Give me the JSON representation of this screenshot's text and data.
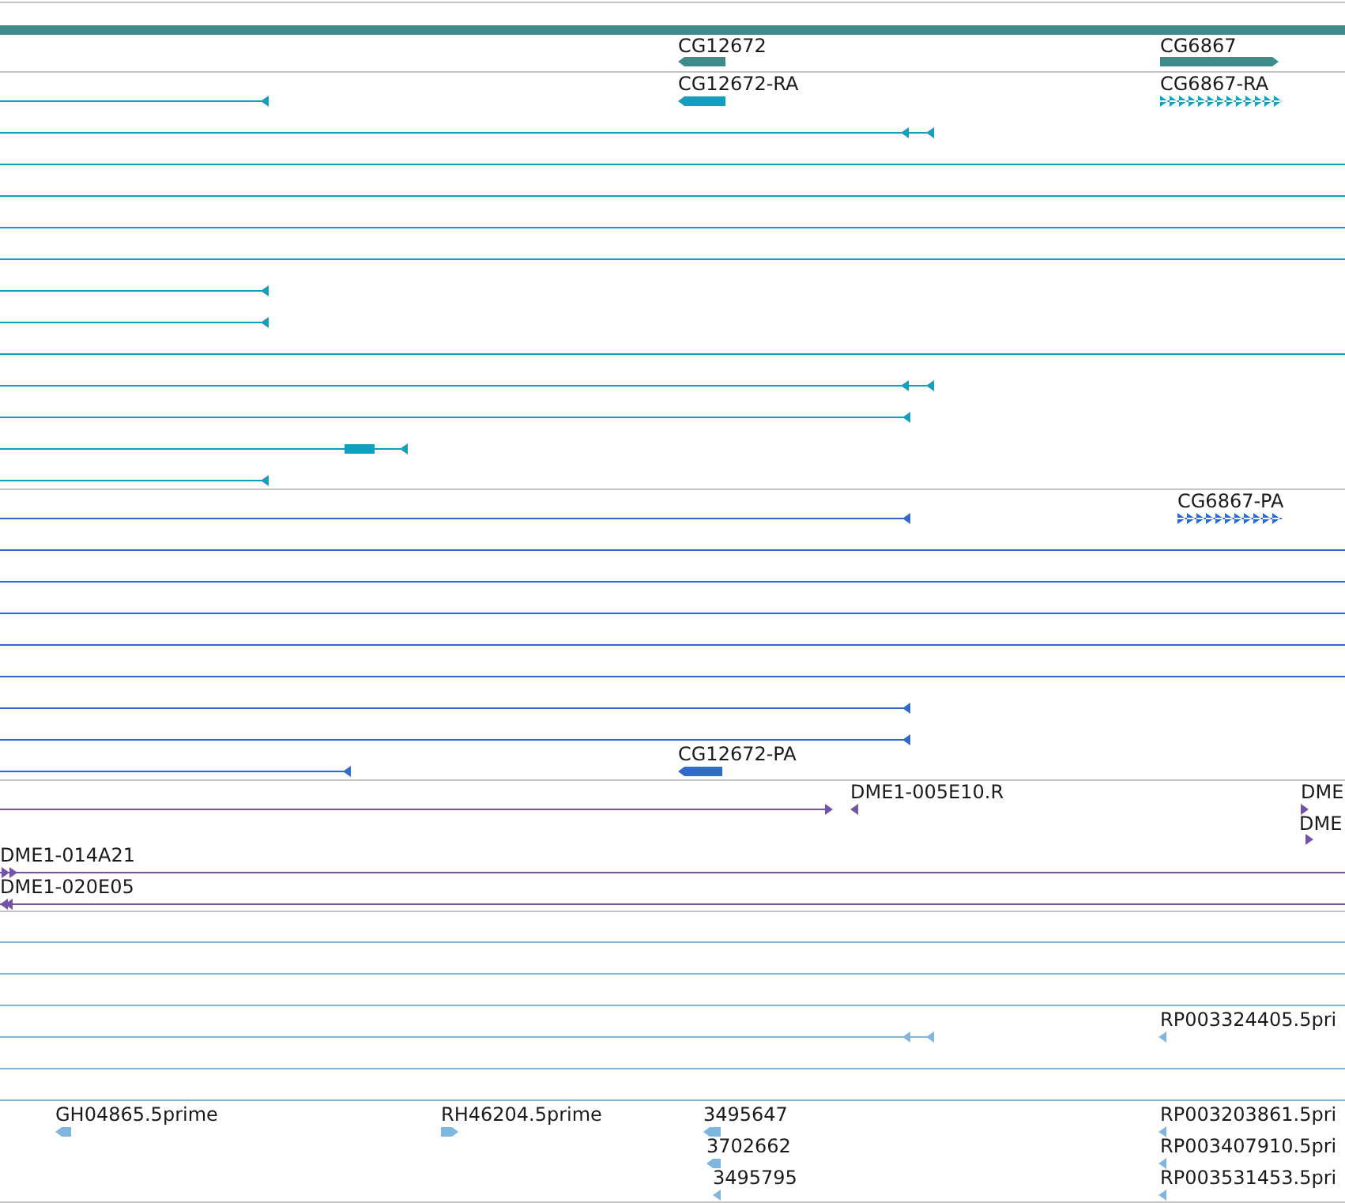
{
  "tracks": [
    {
      "kind": "gene",
      "color": "#3d8b8b",
      "features": [
        {
          "label": "CG12672"
        },
        {
          "label": "CG6867"
        }
      ]
    },
    {
      "kind": "transcript",
      "color": "#119fc0",
      "features": [
        {
          "label": "CG12672-RA"
        },
        {
          "label": "CG6867-RA"
        }
      ]
    },
    {
      "kind": "transcript",
      "color": "#2f6bcf",
      "features": [
        {
          "label": "CG6867-PA"
        },
        {
          "label": "CG12672-PA"
        }
      ]
    },
    {
      "kind": "clone",
      "color": "#7452a8",
      "features": [
        {
          "label": "DME1-005E10.R"
        },
        {
          "label": "DME"
        },
        {
          "label": "DME"
        },
        {
          "label": "DME1-014A21"
        },
        {
          "label": "DME1-020E05"
        }
      ]
    },
    {
      "kind": "est",
      "color": "#7eb6e0",
      "features": [
        {
          "label": "RP003324405.5pri"
        },
        {
          "label": "GH04865.5prime"
        },
        {
          "label": "RH46204.5prime"
        },
        {
          "label": "3495647"
        },
        {
          "label": "3702662"
        },
        {
          "label": "3495795"
        },
        {
          "label": "RP003203861.5pri"
        },
        {
          "label": "RP003407910.5pri"
        },
        {
          "label": "RP003531453.5pri"
        }
      ]
    }
  ]
}
